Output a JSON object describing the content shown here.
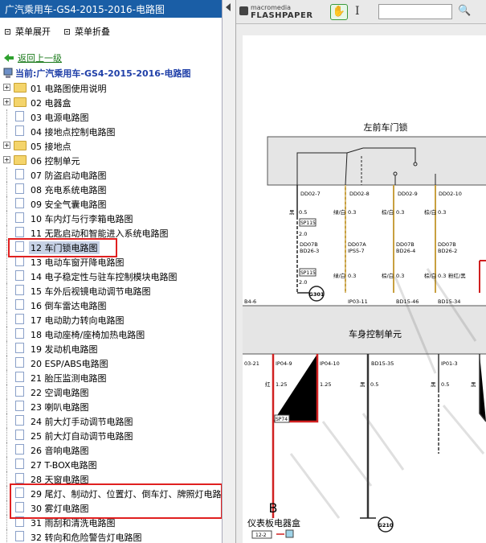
{
  "window": {
    "title": "广汽乘用车-GS4-2015-2016-电路图"
  },
  "menu": {
    "expand_label": "菜单展开",
    "collapse_label": "菜单折叠"
  },
  "nav": {
    "back_label": "返回上一级",
    "current_label": "当前:广汽乘用车-GS4-2015-2016-电路图"
  },
  "tree": {
    "items": [
      {
        "label": "01 电路图使用说明",
        "type": "folder"
      },
      {
        "label": "02 电器盒",
        "type": "folder"
      },
      {
        "label": "03 电源电路图",
        "type": "page"
      },
      {
        "label": "04 接地点控制电路图",
        "type": "page"
      },
      {
        "label": "05 接地点",
        "type": "folder"
      },
      {
        "label": "06 控制单元",
        "type": "folder"
      },
      {
        "label": "07 防盗启动电路图",
        "type": "page"
      },
      {
        "label": "08 充电系统电路图",
        "type": "page"
      },
      {
        "label": "09 安全气囊电路图",
        "type": "page"
      },
      {
        "label": "10 车内灯与行李箱电路图",
        "type": "page"
      },
      {
        "label": "11 无匙启动和智能进入系统电路图",
        "type": "page"
      },
      {
        "label": "12 车门锁电路图",
        "type": "page",
        "selected": true
      },
      {
        "label": "13 电动车窗开降电路图",
        "type": "page"
      },
      {
        "label": "14 电子稳定性与驻车控制模块电路图",
        "type": "page"
      },
      {
        "label": "15 车外后视镜电动调节电路图",
        "type": "page"
      },
      {
        "label": "16 倒车雷达电路图",
        "type": "page"
      },
      {
        "label": "17 电动助力转向电路图",
        "type": "page"
      },
      {
        "label": "18 电动座椅/座椅加热电路图",
        "type": "page"
      },
      {
        "label": "19 发动机电路图",
        "type": "page"
      },
      {
        "label": "20 ESP/ABS电路图",
        "type": "page"
      },
      {
        "label": "21 胎压监测电路图",
        "type": "page"
      },
      {
        "label": "22 空调电路图",
        "type": "page"
      },
      {
        "label": "23 喇叭电路图",
        "type": "page"
      },
      {
        "label": "24 前大灯手动调节电路图",
        "type": "page"
      },
      {
        "label": "25 前大灯自动调节电路图",
        "type": "page"
      },
      {
        "label": "26 音响电路图",
        "type": "page"
      },
      {
        "label": "27 T-BOX电路图",
        "type": "page"
      },
      {
        "label": "28 天窗电路图",
        "type": "page"
      },
      {
        "label": "29 尾灯、制动灯、位置灯、倒车灯、牌照灯电路",
        "type": "page"
      },
      {
        "label": "30 雾灯电路图",
        "type": "page"
      },
      {
        "label": "31 雨刮和清洗电路图",
        "type": "page"
      },
      {
        "label": "32 转向和危险警告灯电路图",
        "type": "page"
      }
    ]
  },
  "viewer": {
    "logo_top": "macromedia",
    "logo_bottom": "FLASHPAPER",
    "search_value": ""
  },
  "diagram": {
    "title_lock": "左前车门锁",
    "title_bcm": "车身控制单元",
    "title_fusebox": "仪表板电器盒",
    "pins_top": [
      "DD02-7",
      "DD02-8",
      "DD02-9",
      "DD02-10"
    ],
    "wires_mid": [
      "黑",
      "绿/白",
      "棕/白",
      "棕/白"
    ],
    "wire_size": "0.3",
    "wire_size_2": "0.5",
    "wire_size_3": "2.0",
    "connectors_mid": [
      "DD07B",
      "DD07A",
      "DD07B",
      "DD07B"
    ],
    "connectors_mid2": [
      "BD26-3",
      "IPS5-7",
      "BD26-4",
      "BD26-2"
    ],
    "splice": "SP115",
    "wires_low": [
      "绿/白",
      "棕/白",
      "棕/白",
      "粉红/黑"
    ],
    "ground_1": "G301",
    "pins_bcm_top": [
      "IP03-11",
      "BD15-46",
      "BD15-34"
    ],
    "bd_left": "B4-6",
    "pins_bcm_bot": [
      "IP04-9",
      "IP04-10",
      "BD15-35",
      "IP01-3"
    ],
    "left_pin": "03-21",
    "wire_red": "红",
    "wire_black": "黑",
    "size_125": "1.25",
    "sp_red": "SP74",
    "ground_2": "G210",
    "connector_b": "B",
    "fuse_ref": "12-2"
  }
}
